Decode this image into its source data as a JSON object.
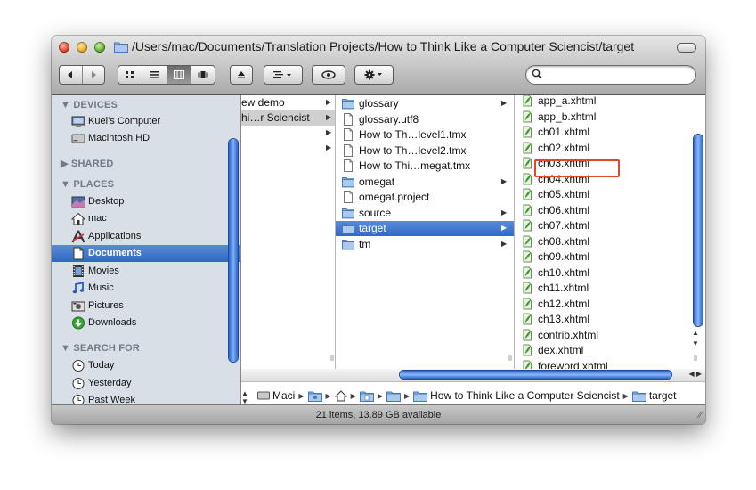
{
  "window": {
    "title": "/Users/mac/Documents/Translation Projects/How to Think Like a Computer Sciencist/target"
  },
  "search": {
    "placeholder": ""
  },
  "sidebar": {
    "sections": [
      {
        "header": "DEVICES",
        "items": [
          {
            "label": "Kuei’s Computer",
            "icon": "computer-icon"
          },
          {
            "label": "Macintosh HD",
            "icon": "harddisk-icon"
          }
        ]
      },
      {
        "header": "SHARED",
        "items": []
      },
      {
        "header": "PLACES",
        "items": [
          {
            "label": "Desktop",
            "icon": "desktop-icon"
          },
          {
            "label": "mac",
            "icon": "home-icon"
          },
          {
            "label": "Applications",
            "icon": "applications-icon"
          },
          {
            "label": "Documents",
            "icon": "documents-icon",
            "selected": true
          },
          {
            "label": "Movies",
            "icon": "movies-icon"
          },
          {
            "label": "Music",
            "icon": "music-icon"
          },
          {
            "label": "Pictures",
            "icon": "pictures-icon"
          },
          {
            "label": "Downloads",
            "icon": "downloads-icon"
          }
        ]
      },
      {
        "header": "SEARCH FOR",
        "items": [
          {
            "label": "Today",
            "icon": "clock-icon"
          },
          {
            "label": "Yesterday",
            "icon": "clock-icon"
          },
          {
            "label": "Past Week",
            "icon": "clock-icon"
          }
        ]
      }
    ]
  },
  "columns": {
    "col1": [
      {
        "label": "ew demo",
        "arrow": true
      },
      {
        "label": "hi…r Sciencist",
        "arrow": true,
        "selected": true
      },
      {
        "label": "",
        "arrow": true
      },
      {
        "label": "",
        "arrow": true
      }
    ],
    "col2": [
      {
        "label": "glossary",
        "type": "folder",
        "arrow": true
      },
      {
        "label": "glossary.utf8",
        "type": "file"
      },
      {
        "label": "How to Th…level1.tmx",
        "type": "file"
      },
      {
        "label": "How to Th…level2.tmx",
        "type": "file"
      },
      {
        "label": "How to Thi…megat.tmx",
        "type": "file"
      },
      {
        "label": "omegat",
        "type": "folder",
        "arrow": true
      },
      {
        "label": "omegat.project",
        "type": "file"
      },
      {
        "label": "source",
        "type": "folder",
        "arrow": true
      },
      {
        "label": "target",
        "type": "folder",
        "arrow": true,
        "selected": true
      },
      {
        "label": "tm",
        "type": "folder",
        "arrow": true
      }
    ],
    "col3": [
      "app_a.xhtml",
      "app_b.xhtml",
      "ch01.xhtml",
      "ch02.xhtml",
      "ch03.xhtml",
      "ch04.xhtml",
      "ch05.xhtml",
      "ch06.xhtml",
      "ch07.xhtml",
      "ch08.xhtml",
      "ch09.xhtml",
      "ch10.xhtml",
      "ch11.xhtml",
      "ch12.xhtml",
      "ch13.xhtml",
      "contrib.xhtml",
      "dex.xhtml",
      "foreword.xhtml"
    ],
    "col3_highlighted": "ch01.xhtml"
  },
  "pathbar": {
    "segments": [
      "Maci",
      "",
      "",
      "",
      "",
      "How to Think Like a Computer Sciencist",
      "target"
    ]
  },
  "status": {
    "text": "21 items, 13.89 GB available"
  },
  "colors": {
    "selection": "#3a72cc",
    "highlight_box": "#d94b2b",
    "sidebar_bg": "#d9dfe7"
  }
}
